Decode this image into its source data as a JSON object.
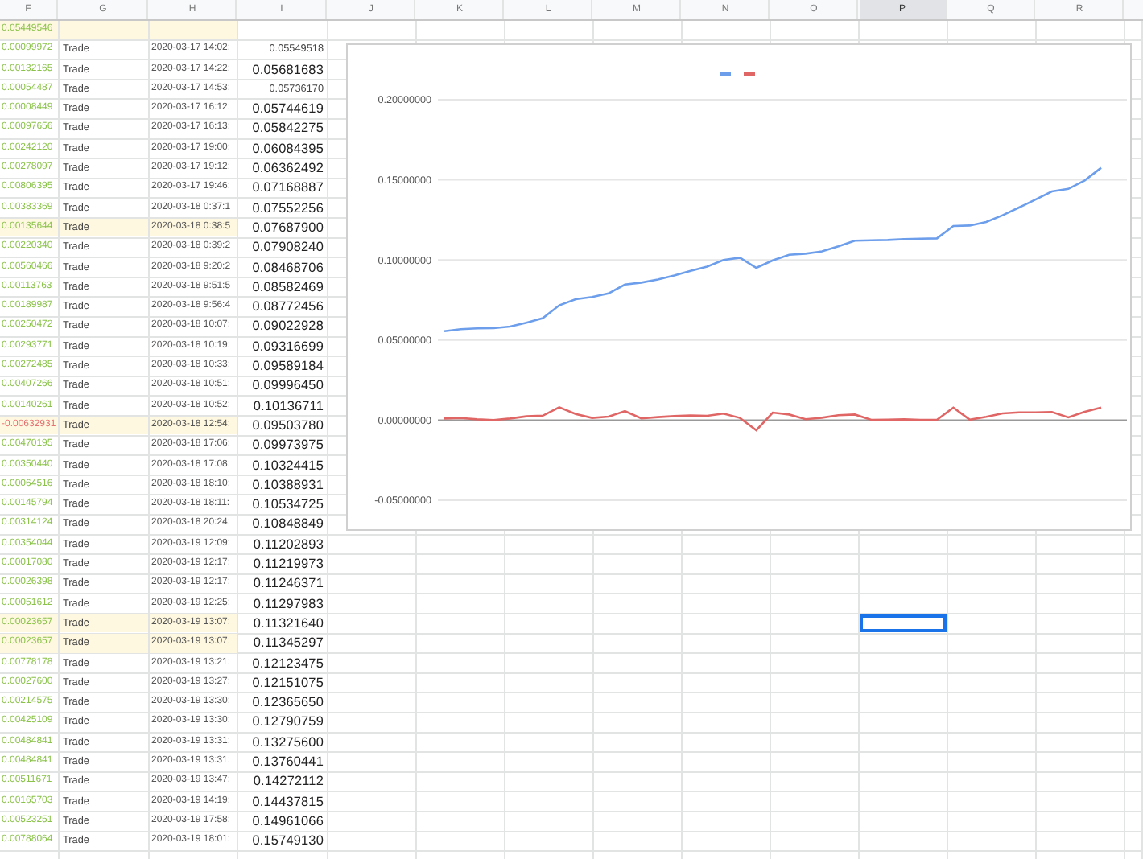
{
  "columns": [
    {
      "label": "F",
      "selected": false
    },
    {
      "label": "G",
      "selected": false
    },
    {
      "label": "H",
      "selected": false
    },
    {
      "label": "I",
      "selected": false
    },
    {
      "label": "J",
      "selected": false
    },
    {
      "label": "K",
      "selected": false
    },
    {
      "label": "L",
      "selected": false
    },
    {
      "label": "M",
      "selected": false
    },
    {
      "label": "N",
      "selected": false
    },
    {
      "label": "O",
      "selected": false
    },
    {
      "label": "P",
      "selected": true
    },
    {
      "label": "Q",
      "selected": false
    },
    {
      "label": "R",
      "selected": false
    }
  ],
  "rows": [
    {
      "change": "0.05449546",
      "loss": false,
      "highlighted": true,
      "selected": false
    },
    {
      "change": "0.00099972",
      "type": "Trade",
      "time": "2020-03-17 14:02:",
      "total": "0.05549518",
      "large": false,
      "loss": false,
      "highlighted": false,
      "selected": false
    },
    {
      "change": "0.00132165",
      "type": "Trade",
      "time": "2020-03-17 14:22:",
      "total": "0.05681683",
      "large": true,
      "loss": false,
      "highlighted": false,
      "selected": false
    },
    {
      "change": "0.00054487",
      "type": "Trade",
      "time": "2020-03-17 14:53:",
      "total": "0.05736170",
      "large": false,
      "loss": false,
      "highlighted": false,
      "selected": false
    },
    {
      "change": "0.00008449",
      "type": "Trade",
      "time": "2020-03-17 16:12:",
      "total": "0.05744619",
      "large": true,
      "loss": false,
      "highlighted": false,
      "selected": false
    },
    {
      "change": "0.00097656",
      "type": "Trade",
      "time": "2020-03-17 16:13:",
      "total": "0.05842275",
      "large": true,
      "loss": false,
      "highlighted": false,
      "selected": false
    },
    {
      "change": "0.00242120",
      "type": "Trade",
      "time": "2020-03-17 19:00:",
      "total": "0.06084395",
      "large": true,
      "loss": false,
      "highlighted": false,
      "selected": false
    },
    {
      "change": "0.00278097",
      "type": "Trade",
      "time": "2020-03-17 19:12:",
      "total": "0.06362492",
      "large": true,
      "loss": false,
      "highlighted": false,
      "selected": false
    },
    {
      "change": "0.00806395",
      "type": "Trade",
      "time": "2020-03-17 19:46:",
      "total": "0.07168887",
      "large": true,
      "loss": false,
      "highlighted": false,
      "selected": false
    },
    {
      "change": "0.00383369",
      "type": "Trade",
      "time": "2020-03-18 0:37:1",
      "total": "0.07552256",
      "large": true,
      "loss": false,
      "highlighted": false,
      "selected": false
    },
    {
      "change": "0.00135644",
      "type": "Trade",
      "time": "2020-03-18 0:38:5",
      "total": "0.07687900",
      "large": true,
      "loss": false,
      "highlighted": true,
      "selected": false
    },
    {
      "change": "0.00220340",
      "type": "Trade",
      "time": "2020-03-18 0:39:2",
      "total": "0.07908240",
      "large": true,
      "loss": false,
      "highlighted": false,
      "selected": false
    },
    {
      "change": "0.00560466",
      "type": "Trade",
      "time": "2020-03-18 9:20:2",
      "total": "0.08468706",
      "large": true,
      "loss": false,
      "highlighted": false,
      "selected": false
    },
    {
      "change": "0.00113763",
      "type": "Trade",
      "time": "2020-03-18 9:51:5",
      "total": "0.08582469",
      "large": true,
      "loss": false,
      "highlighted": false,
      "selected": false
    },
    {
      "change": "0.00189987",
      "type": "Trade",
      "time": "2020-03-18 9:56:4",
      "total": "0.08772456",
      "large": true,
      "loss": false,
      "highlighted": false,
      "selected": false
    },
    {
      "change": "0.00250472",
      "type": "Trade",
      "time": "2020-03-18 10:07:",
      "total": "0.09022928",
      "large": true,
      "loss": false,
      "highlighted": false,
      "selected": false
    },
    {
      "change": "0.00293771",
      "type": "Trade",
      "time": "2020-03-18 10:19:",
      "total": "0.09316699",
      "large": true,
      "loss": false,
      "highlighted": false,
      "selected": false
    },
    {
      "change": "0.00272485",
      "type": "Trade",
      "time": "2020-03-18 10:33:",
      "total": "0.09589184",
      "large": true,
      "loss": false,
      "highlighted": false,
      "selected": false
    },
    {
      "change": "0.00407266",
      "type": "Trade",
      "time": "2020-03-18 10:51:",
      "total": "0.09996450",
      "large": true,
      "loss": false,
      "highlighted": false,
      "selected": false
    },
    {
      "change": "0.00140261",
      "type": "Trade",
      "time": "2020-03-18 10:52:",
      "total": "0.10136711",
      "large": true,
      "loss": false,
      "highlighted": false,
      "selected": false
    },
    {
      "change": "-0.00632931",
      "type": "Trade",
      "time": "2020-03-18 12:54:",
      "total": "0.09503780",
      "large": true,
      "loss": true,
      "highlighted": true,
      "selected": false
    },
    {
      "change": "0.00470195",
      "type": "Trade",
      "time": "2020-03-18 17:06:",
      "total": "0.09973975",
      "large": true,
      "loss": false,
      "highlighted": false,
      "selected": false
    },
    {
      "change": "0.00350440",
      "type": "Trade",
      "time": "2020-03-18 17:08:",
      "total": "0.10324415",
      "large": true,
      "loss": false,
      "highlighted": false,
      "selected": false
    },
    {
      "change": "0.00064516",
      "type": "Trade",
      "time": "2020-03-18 18:10:",
      "total": "0.10388931",
      "large": true,
      "loss": false,
      "highlighted": false,
      "selected": false
    },
    {
      "change": "0.00145794",
      "type": "Trade",
      "time": "2020-03-18 18:11:",
      "total": "0.10534725",
      "large": true,
      "loss": false,
      "highlighted": false,
      "selected": false
    },
    {
      "change": "0.00314124",
      "type": "Trade",
      "time": "2020-03-18 20:24:",
      "total": "0.10848849",
      "large": true,
      "loss": false,
      "highlighted": false,
      "selected": false
    },
    {
      "change": "0.00354044",
      "type": "Trade",
      "time": "2020-03-19 12:09:",
      "total": "0.11202893",
      "large": true,
      "loss": false,
      "highlighted": false,
      "selected": false
    },
    {
      "change": "0.00017080",
      "type": "Trade",
      "time": "2020-03-19 12:17:",
      "total": "0.11219973",
      "large": true,
      "loss": false,
      "highlighted": false,
      "selected": false
    },
    {
      "change": "0.00026398",
      "type": "Trade",
      "time": "2020-03-19 12:17:",
      "total": "0.11246371",
      "large": true,
      "loss": false,
      "highlighted": false,
      "selected": false
    },
    {
      "change": "0.00051612",
      "type": "Trade",
      "time": "2020-03-19 12:25:",
      "total": "0.11297983",
      "large": true,
      "loss": false,
      "highlighted": false,
      "selected": false
    },
    {
      "change": "0.00023657",
      "type": "Trade",
      "time": "2020-03-19 13:07:",
      "total": "0.11321640",
      "large": true,
      "loss": false,
      "highlighted": true,
      "selected": true
    },
    {
      "change": "0.00023657",
      "type": "Trade",
      "time": "2020-03-19 13:07:",
      "total": "0.11345297",
      "large": true,
      "loss": false,
      "highlighted": true,
      "selected": false
    },
    {
      "change": "0.00778178",
      "type": "Trade",
      "time": "2020-03-19 13:21:",
      "total": "0.12123475",
      "large": true,
      "loss": false,
      "highlighted": false,
      "selected": false
    },
    {
      "change": "0.00027600",
      "type": "Trade",
      "time": "2020-03-19 13:27:",
      "total": "0.12151075",
      "large": true,
      "loss": false,
      "highlighted": false,
      "selected": false
    },
    {
      "change": "0.00214575",
      "type": "Trade",
      "time": "2020-03-19 13:30:",
      "total": "0.12365650",
      "large": true,
      "loss": false,
      "highlighted": false,
      "selected": false
    },
    {
      "change": "0.00425109",
      "type": "Trade",
      "time": "2020-03-19 13:30:",
      "total": "0.12790759",
      "large": true,
      "loss": false,
      "highlighted": false,
      "selected": false
    },
    {
      "change": "0.00484841",
      "type": "Trade",
      "time": "2020-03-19 13:31:",
      "total": "0.13275600",
      "large": true,
      "loss": false,
      "highlighted": false,
      "selected": false
    },
    {
      "change": "0.00484841",
      "type": "Trade",
      "time": "2020-03-19 13:31:",
      "total": "0.13760441",
      "large": true,
      "loss": false,
      "highlighted": false,
      "selected": false
    },
    {
      "change": "0.00511671",
      "type": "Trade",
      "time": "2020-03-19 13:47:",
      "total": "0.14272112",
      "large": true,
      "loss": false,
      "highlighted": false,
      "selected": false
    },
    {
      "change": "0.00165703",
      "type": "Trade",
      "time": "2020-03-19 14:19:",
      "total": "0.14437815",
      "large": true,
      "loss": false,
      "highlighted": false,
      "selected": false
    },
    {
      "change": "0.00523251",
      "type": "Trade",
      "time": "2020-03-19 17:58:",
      "total": "0.14961066",
      "large": true,
      "loss": false,
      "highlighted": false,
      "selected": false
    },
    {
      "change": "0.00788064",
      "type": "Trade",
      "time": "2020-03-19 18:01:",
      "total": "0.15749130",
      "large": true,
      "loss": false,
      "highlighted": false,
      "selected": false
    }
  ],
  "chart": {
    "chart_data": {
      "type": "line",
      "ylim": [
        -0.05,
        0.2
      ],
      "grid": true,
      "yticks": [
        {
          "value": 0.2,
          "label": "0.20000000"
        },
        {
          "value": 0.15,
          "label": "0.15000000"
        },
        {
          "value": 0.1,
          "label": "0.10000000"
        },
        {
          "value": 0.05,
          "label": "0.05000000"
        },
        {
          "value": 0,
          "label": "0.00000000"
        },
        {
          "value": -0.05,
          "label": "-0.05000000"
        }
      ],
      "series": [
        {
          "color": "#6d9eeb",
          "values": [
            0.05549518,
            0.05681683,
            0.0573617,
            0.05744619,
            0.05842275,
            0.06084395,
            0.06362492,
            0.07168887,
            0.07552256,
            0.076879,
            0.0790824,
            0.08468706,
            0.08582469,
            0.08772456,
            0.09022928,
            0.09316699,
            0.09589184,
            0.0999645,
            0.10136711,
            0.0950378,
            0.09973975,
            0.10324415,
            0.10388931,
            0.10534725,
            0.10848849,
            0.11202893,
            0.11219973,
            0.11246371,
            0.11297983,
            0.1132164,
            0.11345297,
            0.12123475,
            0.12151075,
            0.1236565,
            0.12790759,
            0.132756,
            0.13760441,
            0.14272112,
            0.14437815,
            0.14961066,
            0.1574913
          ]
        },
        {
          "color": "#e06666",
          "values": [
            0.00099972,
            0.00132165,
            0.00054487,
            8.449e-05,
            0.00097656,
            0.0024212,
            0.00278097,
            0.00806395,
            0.00383369,
            0.00135644,
            0.0022034,
            0.00560466,
            0.00113763,
            0.00189987,
            0.00250472,
            0.00293771,
            0.00272485,
            0.00407266,
            0.00140261,
            -0.00632931,
            0.00470195,
            0.0035044,
            0.00064516,
            0.00145794,
            0.00314124,
            0.00354044,
            0.0001708,
            0.00026398,
            0.00051612,
            0.00023657,
            0.00023657,
            0.00778178,
            0.000276,
            0.00214575,
            0.00425109,
            0.00484841,
            0.00484841,
            0.00511671,
            0.00165703,
            0.00523251,
            0.00788064
          ]
        }
      ]
    }
  }
}
